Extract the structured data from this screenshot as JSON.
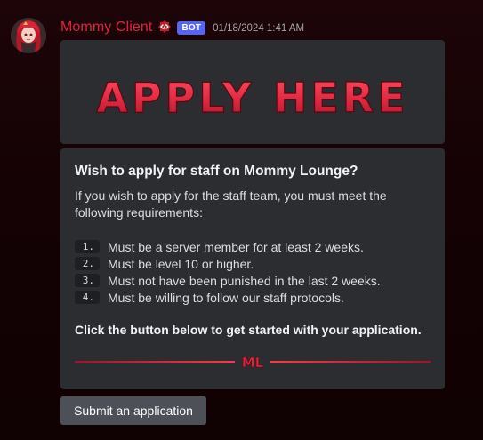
{
  "message": {
    "author": {
      "name": "Mommy Client",
      "bot_tag": "BOT",
      "name_color": "#e0233d",
      "role_icon": "code-shield-icon",
      "avatar": "anime-avatar-red-hair"
    },
    "timestamp": "01/18/2024 1:41 AM"
  },
  "banner": {
    "text": "APPLY HERE",
    "color": "#e32b44"
  },
  "embed": {
    "title": "Wish to apply for staff on Mommy Lounge?",
    "intro": "If you wish to apply for the staff team, you must meet the following requirements:",
    "requirements": [
      {
        "num": "1.",
        "text": "Must be a server member for at least 2 weeks."
      },
      {
        "num": "2.",
        "text": "Must be level 10 or higher."
      },
      {
        "num": "3.",
        "text": "Must not have been punished in the last 2 weeks."
      },
      {
        "num": "4.",
        "text": "Must be willing to follow our staff protocols."
      }
    ],
    "cta": "Click the button below to get started with your application.",
    "divider_logo": "ML",
    "accent_color": "#e0233d",
    "background_color": "#2b2d31"
  },
  "actions": {
    "submit_label": "Submit an application"
  }
}
